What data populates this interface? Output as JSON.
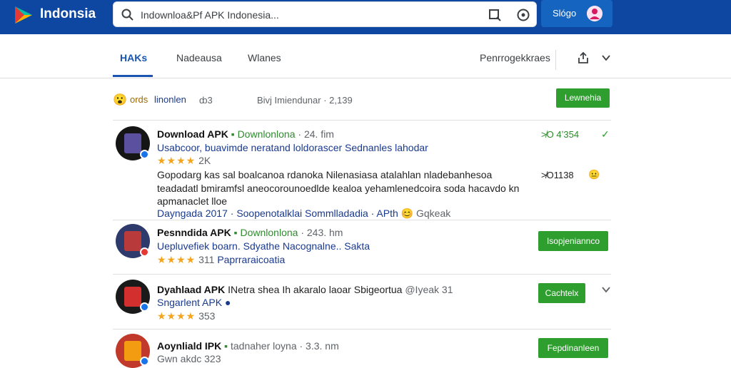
{
  "header": {
    "brand": "Indonsia",
    "search": {
      "value": "Indownloa&Pf APK Indonesia...",
      "placeholder": ""
    },
    "signin_label": "Slógo"
  },
  "tabs": {
    "items": [
      {
        "label": "HAKs"
      },
      {
        "label": "Nadeausa"
      },
      {
        "label": "Wlanes"
      }
    ],
    "right_label": "Penrrogekkraes"
  },
  "filter": {
    "emoji": "😮",
    "label1": "ords",
    "label2": "linonlen",
    "count": "ȸ3",
    "text": "Bivj Imiendunar · 2,139",
    "button": "Lewnehia"
  },
  "items": [
    {
      "title": "Download APK",
      "tag": "Downlonlona",
      "meta": "· 24. fim",
      "subtitle": "Usabcoor, buavimde neratand loldorascer Sednanles lahodar",
      "rating": "★★★★",
      "rating_count": "2K",
      "desc1": "Gopodarg kas sal boalcanoa rdanoka Nilenasiasa atalahlan nladebanhesoa",
      "desc2": "teadadatl bmiramfsl aneocorounoedlde kealoa yehamlenedcoira soda hacavdo kn",
      "desc3": "apmanaclet lloe",
      "footer_pre": "Dayngada 2017 ·",
      "footer_link": "Soopenotalklai Sommlladadia · APth",
      "footer_emoji": "😊",
      "footer_post": "Gqkeak",
      "side1": "≯O 4ʼ354",
      "side2": "≯O1138",
      "side2_emoji": "😐",
      "check": "✓"
    },
    {
      "title": "Pesnndida APK",
      "tag": "Downlonlona",
      "meta": "· 243. hm",
      "subtitle": "Uepluvefiek boarn. Sdyathe Nacognalne.. Sakta",
      "rating": "★★★★",
      "rating_count": "311",
      "rating_text": "Paprraraicoatia",
      "button": "Isopjeniannco"
    },
    {
      "title": "Dyahlaad APK",
      "text": "INetra shea Ih akaralo laoar Sbigeortua",
      "meta": "@Iyeak 31",
      "subtitle": "Sngarlent APK",
      "rating": "★★★★",
      "rating_count": "353",
      "button": "Cachtelx"
    },
    {
      "title": "Aoynliald IPK",
      "meta": "tadnaher loyna · 3.3. nm",
      "subtitle": "Gwn akdc",
      "rating_count": "323",
      "button": "Fepdinanleen"
    }
  ]
}
